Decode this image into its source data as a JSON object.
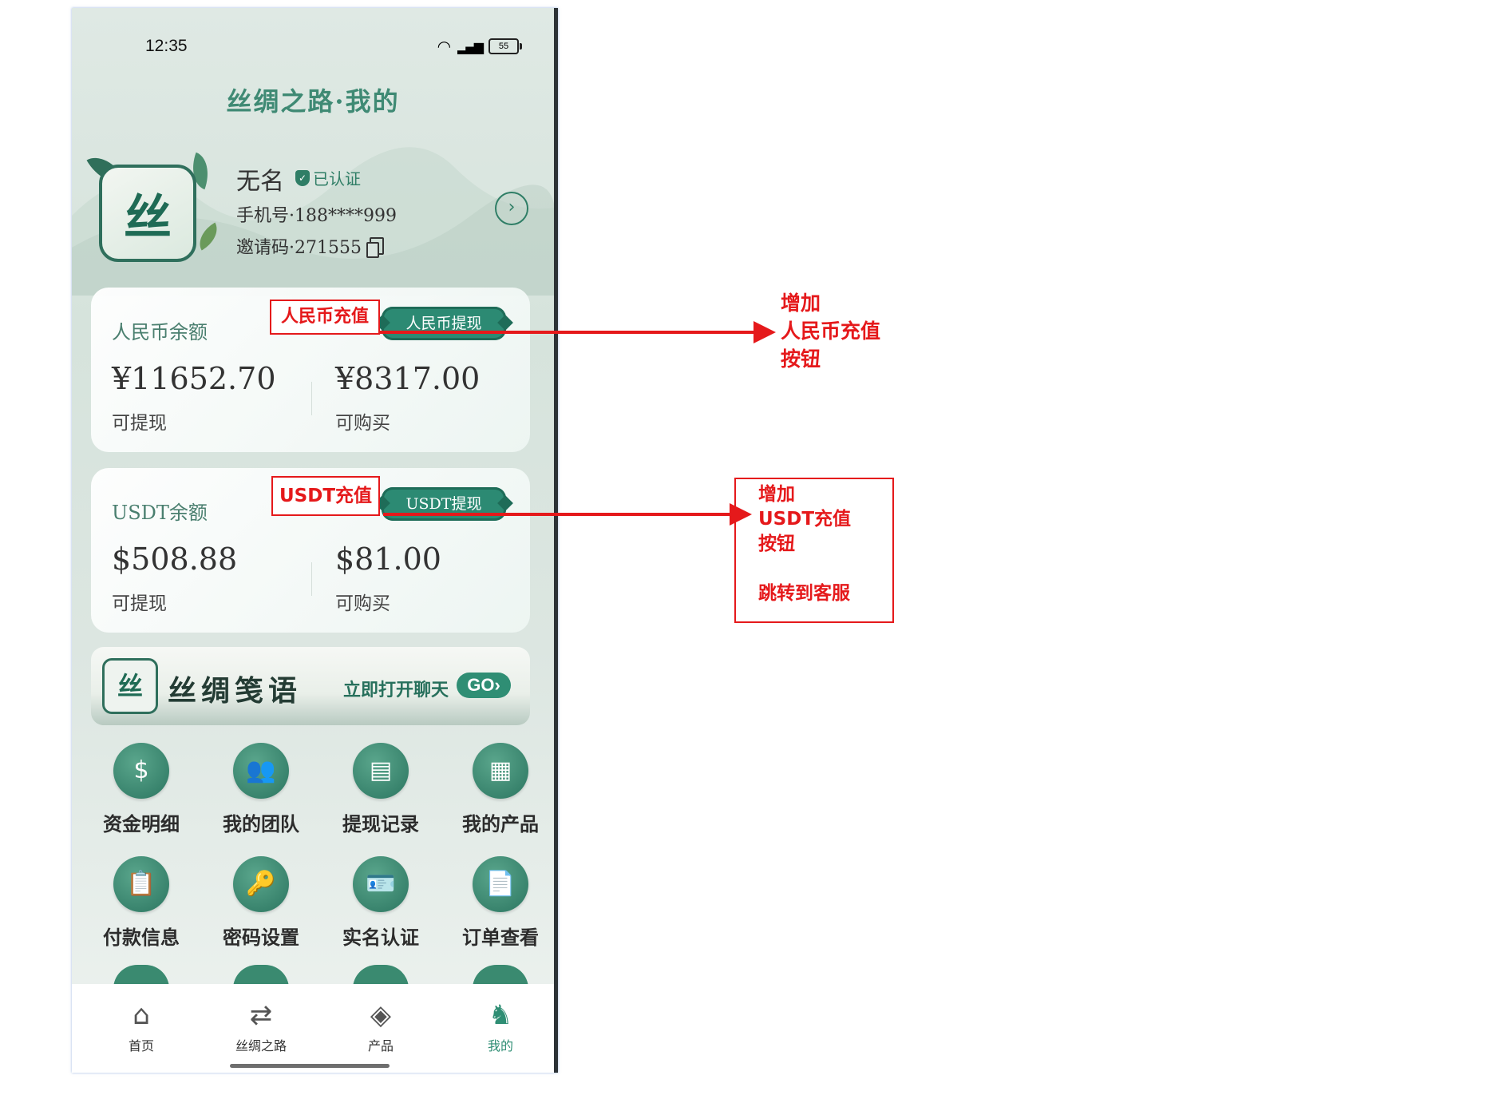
{
  "status": {
    "time": "12:35",
    "battery": "55"
  },
  "page_title": "丝绸之路·我的",
  "user": {
    "name": "无名",
    "verified": "已认证",
    "phone": "手机号·188****999",
    "invite": "邀请码·271555",
    "avatar_text": "丝"
  },
  "rmb_card": {
    "title": "人民币余额",
    "withdraw_btn": "人民币提现",
    "withdrawable_amount": "¥11652.70",
    "withdrawable_label": "可提现",
    "purchasable_amount": "¥8317.00",
    "purchasable_label": "可购买"
  },
  "usdt_card": {
    "title": "USDT余额",
    "withdraw_btn": "USDT提现",
    "withdrawable_amount": "$508.88",
    "withdrawable_label": "可提现",
    "purchasable_amount": "$81.00",
    "purchasable_label": "可购买"
  },
  "banner": {
    "logo_text": "丝",
    "title": "丝绸笺语",
    "cta": "立即打开聊天",
    "go": "GO›"
  },
  "menu": [
    {
      "label": "资金明细",
      "icon": "money-bag-icon",
      "glyph": "$"
    },
    {
      "label": "我的团队",
      "icon": "team-icon",
      "glyph": "👥"
    },
    {
      "label": "提现记录",
      "icon": "withdraw-record-icon",
      "glyph": "▤"
    },
    {
      "label": "我的产品",
      "icon": "products-grid-icon",
      "glyph": "▦"
    },
    {
      "label": "付款信息",
      "icon": "clipboard-icon",
      "glyph": "📋"
    },
    {
      "label": "密码设置",
      "icon": "user-key-icon",
      "glyph": "🔑"
    },
    {
      "label": "实名认证",
      "icon": "id-card-icon",
      "glyph": "🪪"
    },
    {
      "label": "订单查看",
      "icon": "document-icon",
      "glyph": "📄"
    }
  ],
  "tabs": [
    {
      "label": "首页",
      "icon": "home-icon",
      "glyph": "⌂"
    },
    {
      "label": "丝绸之路",
      "icon": "signpost-icon",
      "glyph": "⇄"
    },
    {
      "label": "产品",
      "icon": "box-icon",
      "glyph": "◈"
    },
    {
      "label": "我的",
      "icon": "camel-icon",
      "glyph": "♞"
    }
  ],
  "annotations": {
    "rmb_recharge_box": "人民币充值",
    "usdt_recharge_box": "USDT充值",
    "rmb_note": [
      "增加",
      "人民币充值",
      "按钮"
    ],
    "usdt_note": [
      "增加",
      "USDT充值",
      "按钮",
      "",
      "跳转到客服"
    ]
  },
  "colors": {
    "accent": "#2f8e74",
    "annotation": "#e5191b"
  }
}
